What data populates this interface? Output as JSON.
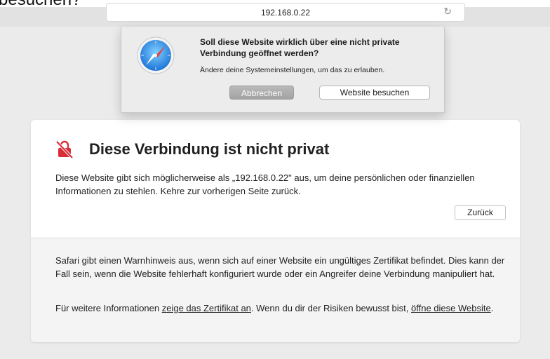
{
  "background_top_text": "besuchen?",
  "address_bar": {
    "url": "192.168.0.22",
    "reload_icon": "reload-icon"
  },
  "dialog": {
    "icon": "safari-compass-icon",
    "title": "Soll diese Website wirklich über eine nicht private Verbindung geöffnet werden?",
    "subtitle": "Ändere deine Systemeinstellungen, um das zu erlauben.",
    "cancel_label": "Abbrechen",
    "visit_label": "Website besuchen"
  },
  "warning": {
    "icon": "warning-lock-icon",
    "title": "Diese Verbindung ist nicht privat",
    "body": "Diese Website gibt sich möglicherweise als „192.168.0.22\" aus, um deine persönlichen oder finanziellen Informationen zu stehlen. Kehre zur vorherigen Seite zurück.",
    "back_label": "Zurück",
    "details": "Safari gibt einen Warnhinweis aus, wenn sich auf einer Website ein ungültiges Zertifikat befindet. Dies kann der Fall sein, wenn die Website fehlerhaft konfiguriert wurde oder ein Angreifer deine Verbindung manipuliert hat.",
    "more_info_prefix": "Für weitere Informationen ",
    "show_cert_link": "zeige das Zertifikat an",
    "more_info_middle": ". Wenn du dir der Risiken bewusst bist, ",
    "open_site_link": "öffne diese Website",
    "more_info_suffix": "."
  },
  "colors": {
    "warning_red": "#d92e3a",
    "cancel_button": "#adadad"
  }
}
